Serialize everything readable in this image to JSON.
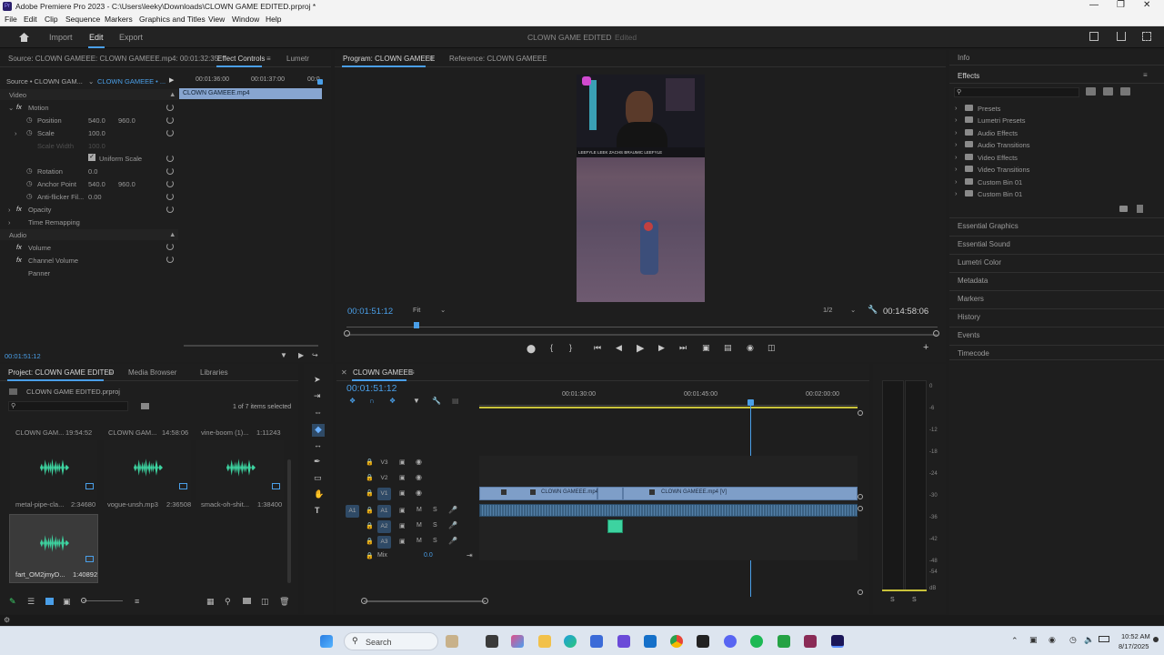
{
  "window": {
    "title": "Adobe Premiere Pro 2023 - C:\\Users\\leeky\\Downloads\\CLOWN GAME EDITED.prproj *"
  },
  "menu": [
    "File",
    "Edit",
    "Clip",
    "Sequence",
    "Markers",
    "Graphics and Titles",
    "View",
    "Window",
    "Help"
  ],
  "workspace": {
    "tabs": [
      "Import",
      "Edit",
      "Export"
    ],
    "active": "Edit",
    "project_title": "CLOWN GAME EDITED",
    "status": "Edited"
  },
  "source_panel": {
    "tabs": [
      "Source: CLOWN GAMEEE: CLOWN GAMEEE.mp4: 00:01:32:35",
      "Effect Controls",
      "Lumetr"
    ],
    "source_select": "Source • CLOWN GAM...",
    "sequence_select": "CLOWN GAMEEE • ...",
    "ruler": [
      "00:01:36:00",
      "00:01:37:00",
      "00:0"
    ],
    "clip_name": "CLOWN GAMEEE.mp4",
    "sections": {
      "video": "Video",
      "audio": "Audio"
    },
    "props": [
      {
        "label": "Motion",
        "fx": true
      },
      {
        "label": "Position",
        "v1": "540.0",
        "v2": "960.0"
      },
      {
        "label": "Scale",
        "v1": "100.0"
      },
      {
        "label": "Scale Width",
        "v1": "100.0",
        "disabled": true
      },
      {
        "label": "Uniform Scale",
        "checkbox": true
      },
      {
        "label": "Rotation",
        "v1": "0.0"
      },
      {
        "label": "Anchor Point",
        "v1": "540.0",
        "v2": "960.0"
      },
      {
        "label": "Anti-flicker Fil...",
        "v1": "0.00"
      },
      {
        "label": "Opacity",
        "fx": true
      },
      {
        "label": "Time Remapping",
        "fx": false
      }
    ],
    "audio_props": [
      {
        "label": "Volume"
      },
      {
        "label": "Channel Volume"
      },
      {
        "label": "Panner"
      }
    ],
    "timecode": "00:01:51:12"
  },
  "program": {
    "tabs": [
      "Program: CLOWN GAMEEE",
      "Reference: CLOWN GAMEEE"
    ],
    "timecode": "00:01:51:12",
    "fit": "Fit",
    "resolution": "1/2",
    "duration": "00:14:58:06",
    "overlay_names": [
      "LEEFYLE",
      "LEEK",
      "ZACHS",
      "BRAUMIC",
      "LEEFYLE"
    ]
  },
  "right_panels": {
    "info": "Info",
    "effects": "Effects",
    "effects_items": [
      "Presets",
      "Lumetri Presets",
      "Audio Effects",
      "Audio Transitions",
      "Video Effects",
      "Video Transitions",
      "Custom Bin 01",
      "Custom Bin 01"
    ],
    "others": [
      "Essential Graphics",
      "Essential Sound",
      "Lumetri Color",
      "Metadata",
      "Markers",
      "History",
      "Events",
      "Timecode"
    ]
  },
  "project": {
    "tabs": [
      "Project: CLOWN GAME EDITED",
      "Media Browser",
      "Libraries"
    ],
    "file": "CLOWN GAME EDITED.prproj",
    "selection": "1 of 7 items selected",
    "top_row": [
      {
        "name": "CLOWN GAM...",
        "dur": "19:54:52"
      },
      {
        "name": "CLOWN GAM...",
        "dur": "14:58:06"
      },
      {
        "name": "vine-boom (1)...",
        "dur": "1:11243"
      }
    ],
    "items": [
      {
        "name": "metal-pipe-cla...",
        "dur": "2:34680"
      },
      {
        "name": "vogue-unsh.mp3",
        "dur": "2:36508"
      },
      {
        "name": "smack-oh-shit...",
        "dur": "1:38400"
      },
      {
        "name": "fart_OM2jmyD...",
        "dur": "1:40892"
      }
    ]
  },
  "timeline": {
    "title": "CLOWN GAMEEE",
    "timecode": "00:01:51:12",
    "ruler": [
      "00:01:30:00",
      "00:01:45:00",
      "00:02:00:00"
    ],
    "video_tracks": [
      "V3",
      "V2",
      "V1"
    ],
    "audio_tracks": [
      "A1",
      "A2",
      "A3"
    ],
    "source_patch": "A1",
    "mix_label": "Mix",
    "mix_value": "0.0",
    "clips": [
      "CLOWN GAMEEE.mp4 [",
      "CLOWN GAMEEE.mp4 [V]"
    ]
  },
  "meter": {
    "scale": [
      "0",
      "-6",
      "-12",
      "-18",
      "-24",
      "-30",
      "-36",
      "-42",
      "-48",
      "-54",
      "dB"
    ],
    "solo": [
      "S",
      "S"
    ]
  },
  "taskbar": {
    "search": "Search",
    "time": "10:52 AM",
    "date": "8/17/2025"
  },
  "colors": {
    "accent": "#2d8ceb",
    "audio_wave": "#3dd3a0",
    "video_clip": "#7e9ec8",
    "playhead": "#4a9fe8"
  }
}
